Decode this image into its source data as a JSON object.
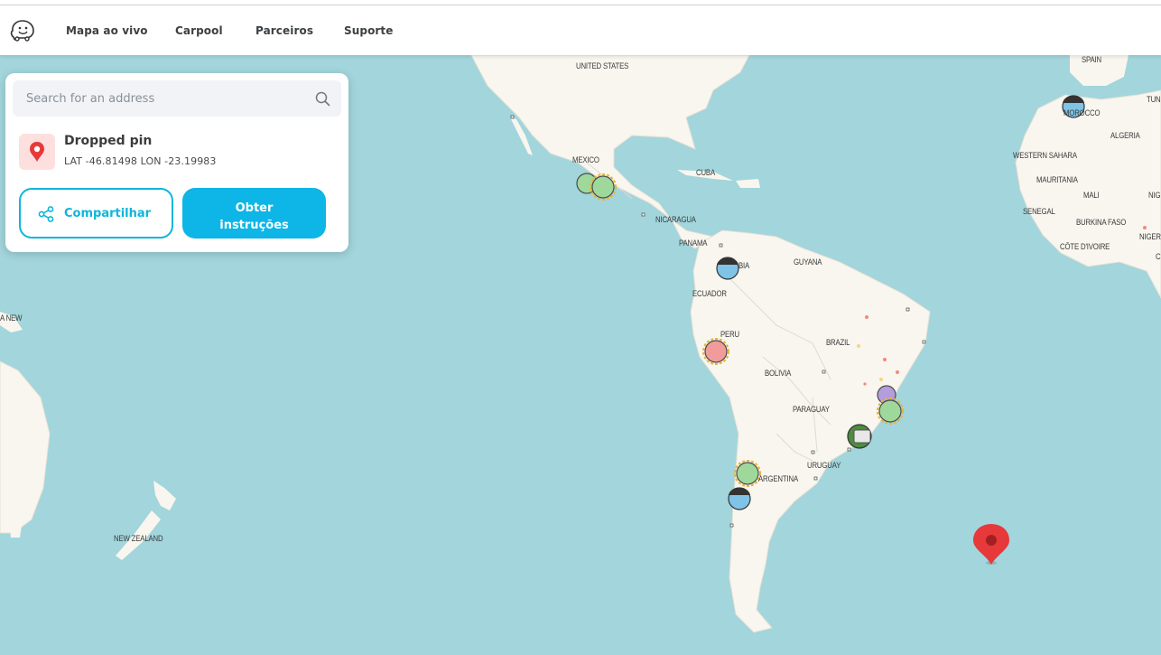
{
  "nav": {
    "logo": "waze-logo",
    "items": [
      "Mapa ao vivo",
      "Carpool",
      "Parceiros",
      "Suporte"
    ]
  },
  "panel": {
    "search_placeholder": "Search for an address",
    "pin_title": "Dropped pin",
    "pin_coords": "LAT -46.81498 LON -23.19983",
    "share_label": "Compartilhar",
    "directions_line1": "Obter",
    "directions_line2": "instruções"
  },
  "map": {
    "labels": [
      "UNITED STATES",
      "MEXICO",
      "CUBA",
      "NICARAGUA",
      "PANAMA",
      "BIA",
      "GUYANA",
      "ECUADOR",
      "PERU",
      "BRAZIL",
      "BOLIVIA",
      "PARAGUAY",
      "URUGUAY",
      "ARGENTINA",
      "NEW ZEALAND",
      "A NEW",
      "SPAIN",
      "TUNI",
      "MOROCCO",
      "ALGERIA",
      "WESTERN SAHARA",
      "MAURITANIA",
      "MALI",
      "NIG",
      "SENEGAL",
      "BURKINA FASO",
      "NIGERIA",
      "CÔTE D'IVOIRE",
      "C"
    ],
    "colors": {
      "water": "#a2d5dc",
      "land": "#f8f6ef",
      "accent": "#0db6e6",
      "pin": "#e7383a"
    }
  }
}
